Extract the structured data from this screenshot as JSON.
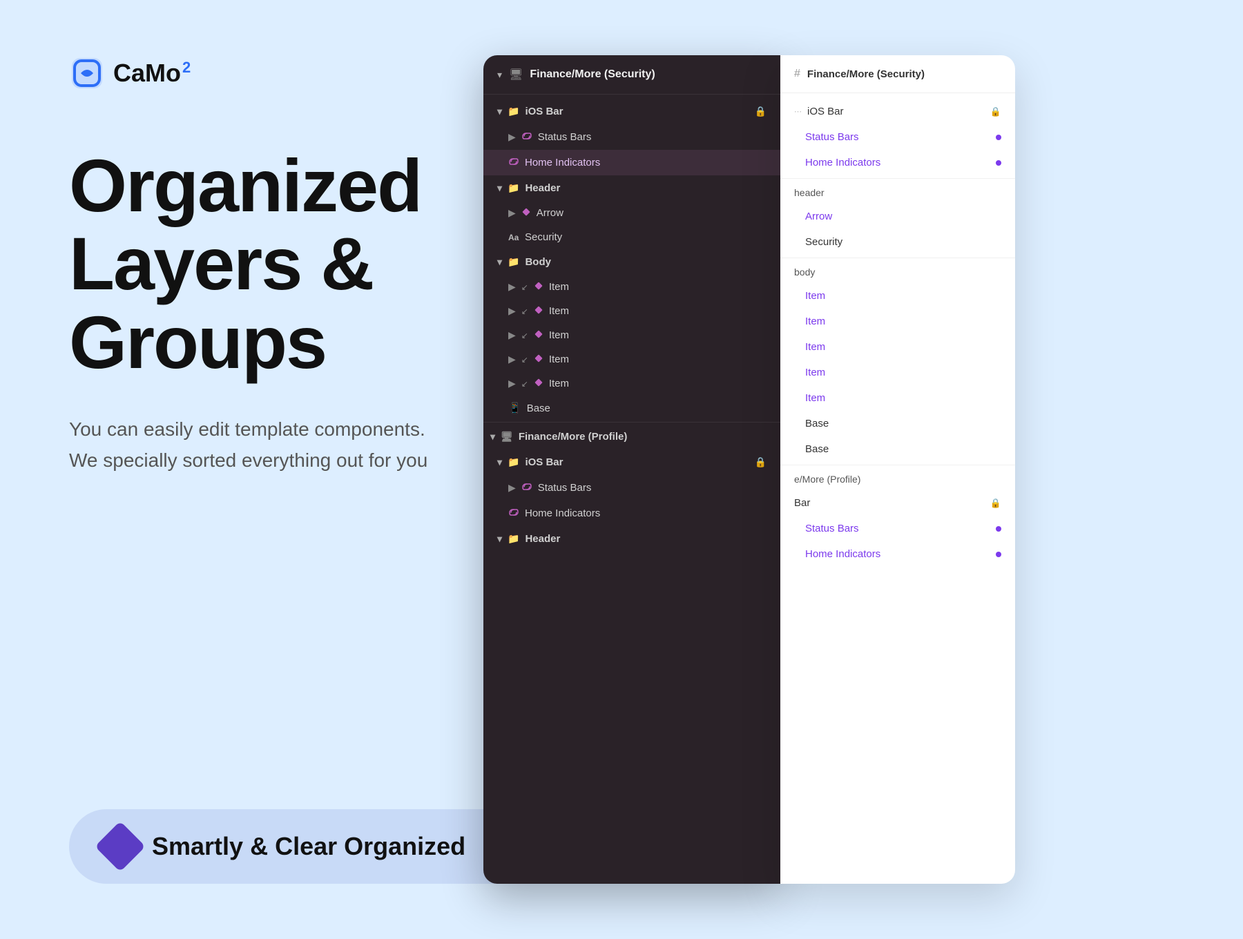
{
  "logo": {
    "text": "CaMo",
    "superscript": "2"
  },
  "heading": {
    "line1": "Organized",
    "line2": "Layers & Groups"
  },
  "subtext": {
    "line1": "You can easily edit template components.",
    "line2": "We specially sorted everything out for you"
  },
  "badge": {
    "label": "Smartly & Clear Organized"
  },
  "layers_panel": {
    "header_title": "Finance/More (Security)",
    "sections": [
      {
        "id": "ios-bar-1",
        "label": "iOS Bar",
        "locked": true,
        "indent": 1,
        "type": "folder",
        "children": [
          {
            "id": "status-bars-1",
            "label": "Status Bars",
            "type": "link",
            "indent": 2,
            "hasArrow": true
          },
          {
            "id": "home-indicators-1",
            "label": "Home Indicators",
            "type": "link",
            "indent": 2,
            "hasArrow": false,
            "highlighted": true
          }
        ]
      },
      {
        "id": "header-1",
        "label": "Header",
        "indent": 1,
        "type": "folder",
        "children": [
          {
            "id": "arrow-1",
            "label": "Arrow",
            "type": "component",
            "indent": 2,
            "hasArrow": true
          },
          {
            "id": "security-1",
            "label": "Security",
            "type": "text",
            "indent": 2,
            "hasArrow": false
          }
        ]
      },
      {
        "id": "body-1",
        "label": "Body",
        "indent": 1,
        "type": "folder",
        "children": [
          {
            "id": "item-1",
            "label": "Item",
            "type": "component",
            "indent": 2,
            "hasArrow": true,
            "hasSort": true
          },
          {
            "id": "item-2",
            "label": "Item",
            "type": "component",
            "indent": 2,
            "hasArrow": true,
            "hasSort": true
          },
          {
            "id": "item-3",
            "label": "Item",
            "type": "component",
            "indent": 2,
            "hasArrow": true,
            "hasSort": true
          },
          {
            "id": "item-4",
            "label": "Item",
            "type": "component",
            "indent": 2,
            "hasArrow": true,
            "hasSort": true
          },
          {
            "id": "item-5",
            "label": "Item",
            "type": "component",
            "indent": 2,
            "hasArrow": true,
            "hasSort": true
          },
          {
            "id": "base-1",
            "label": "Base",
            "type": "phone",
            "indent": 2,
            "hasArrow": false
          }
        ]
      },
      {
        "id": "finance-profile",
        "label": "Finance/More (Profile)",
        "indent": 0,
        "type": "folder",
        "children": [
          {
            "id": "ios-bar-2",
            "label": "iOS Bar",
            "locked": true,
            "indent": 1,
            "type": "folder",
            "children": [
              {
                "id": "status-bars-2",
                "label": "Status Bars",
                "type": "link",
                "indent": 2,
                "hasArrow": true
              },
              {
                "id": "home-indicators-2",
                "label": "Home Indicators",
                "type": "link",
                "indent": 2,
                "hasArrow": false
              }
            ]
          },
          {
            "id": "header-2",
            "label": "Header",
            "indent": 1,
            "type": "folder",
            "children": []
          }
        ]
      }
    ]
  },
  "properties_panel": {
    "header_title": "Finance/More (Security)",
    "items": [
      {
        "id": "ios-bar-prop",
        "label": "iOS Bar",
        "type": "normal",
        "locked": true
      },
      {
        "id": "status-bars-prop",
        "label": "Status Bars",
        "type": "purple",
        "dot": true
      },
      {
        "id": "home-indicators-prop",
        "label": "Home Indicators",
        "type": "purple",
        "dot": true
      },
      {
        "id": "header-prop",
        "label": "header",
        "type": "normal"
      },
      {
        "id": "arrow-prop",
        "label": "Arrow",
        "type": "purple"
      },
      {
        "id": "security-prop",
        "label": "Security",
        "type": "normal"
      },
      {
        "id": "body-prop",
        "label": "body",
        "type": "normal"
      },
      {
        "id": "item-prop-1",
        "label": "Item",
        "type": "purple"
      },
      {
        "id": "item-prop-2",
        "label": "Item",
        "type": "purple"
      },
      {
        "id": "item-prop-3",
        "label": "Item",
        "type": "purple"
      },
      {
        "id": "item-prop-4",
        "label": "Item",
        "type": "purple"
      },
      {
        "id": "item-prop-5",
        "label": "Item",
        "type": "purple"
      },
      {
        "id": "base-prop-1",
        "label": "Base",
        "type": "normal"
      },
      {
        "id": "base-prop-2",
        "label": "Base",
        "type": "normal"
      },
      {
        "id": "profile-prop",
        "label": "e/More (Profile)",
        "type": "normal"
      },
      {
        "id": "bar-prop",
        "label": "Bar",
        "type": "normal",
        "locked": true
      },
      {
        "id": "status-bars-prop-2",
        "label": "Status Bars",
        "type": "purple",
        "dot": true
      },
      {
        "id": "home-indicators-prop-2",
        "label": "Home Indicators",
        "type": "purple",
        "dot": true
      }
    ]
  }
}
